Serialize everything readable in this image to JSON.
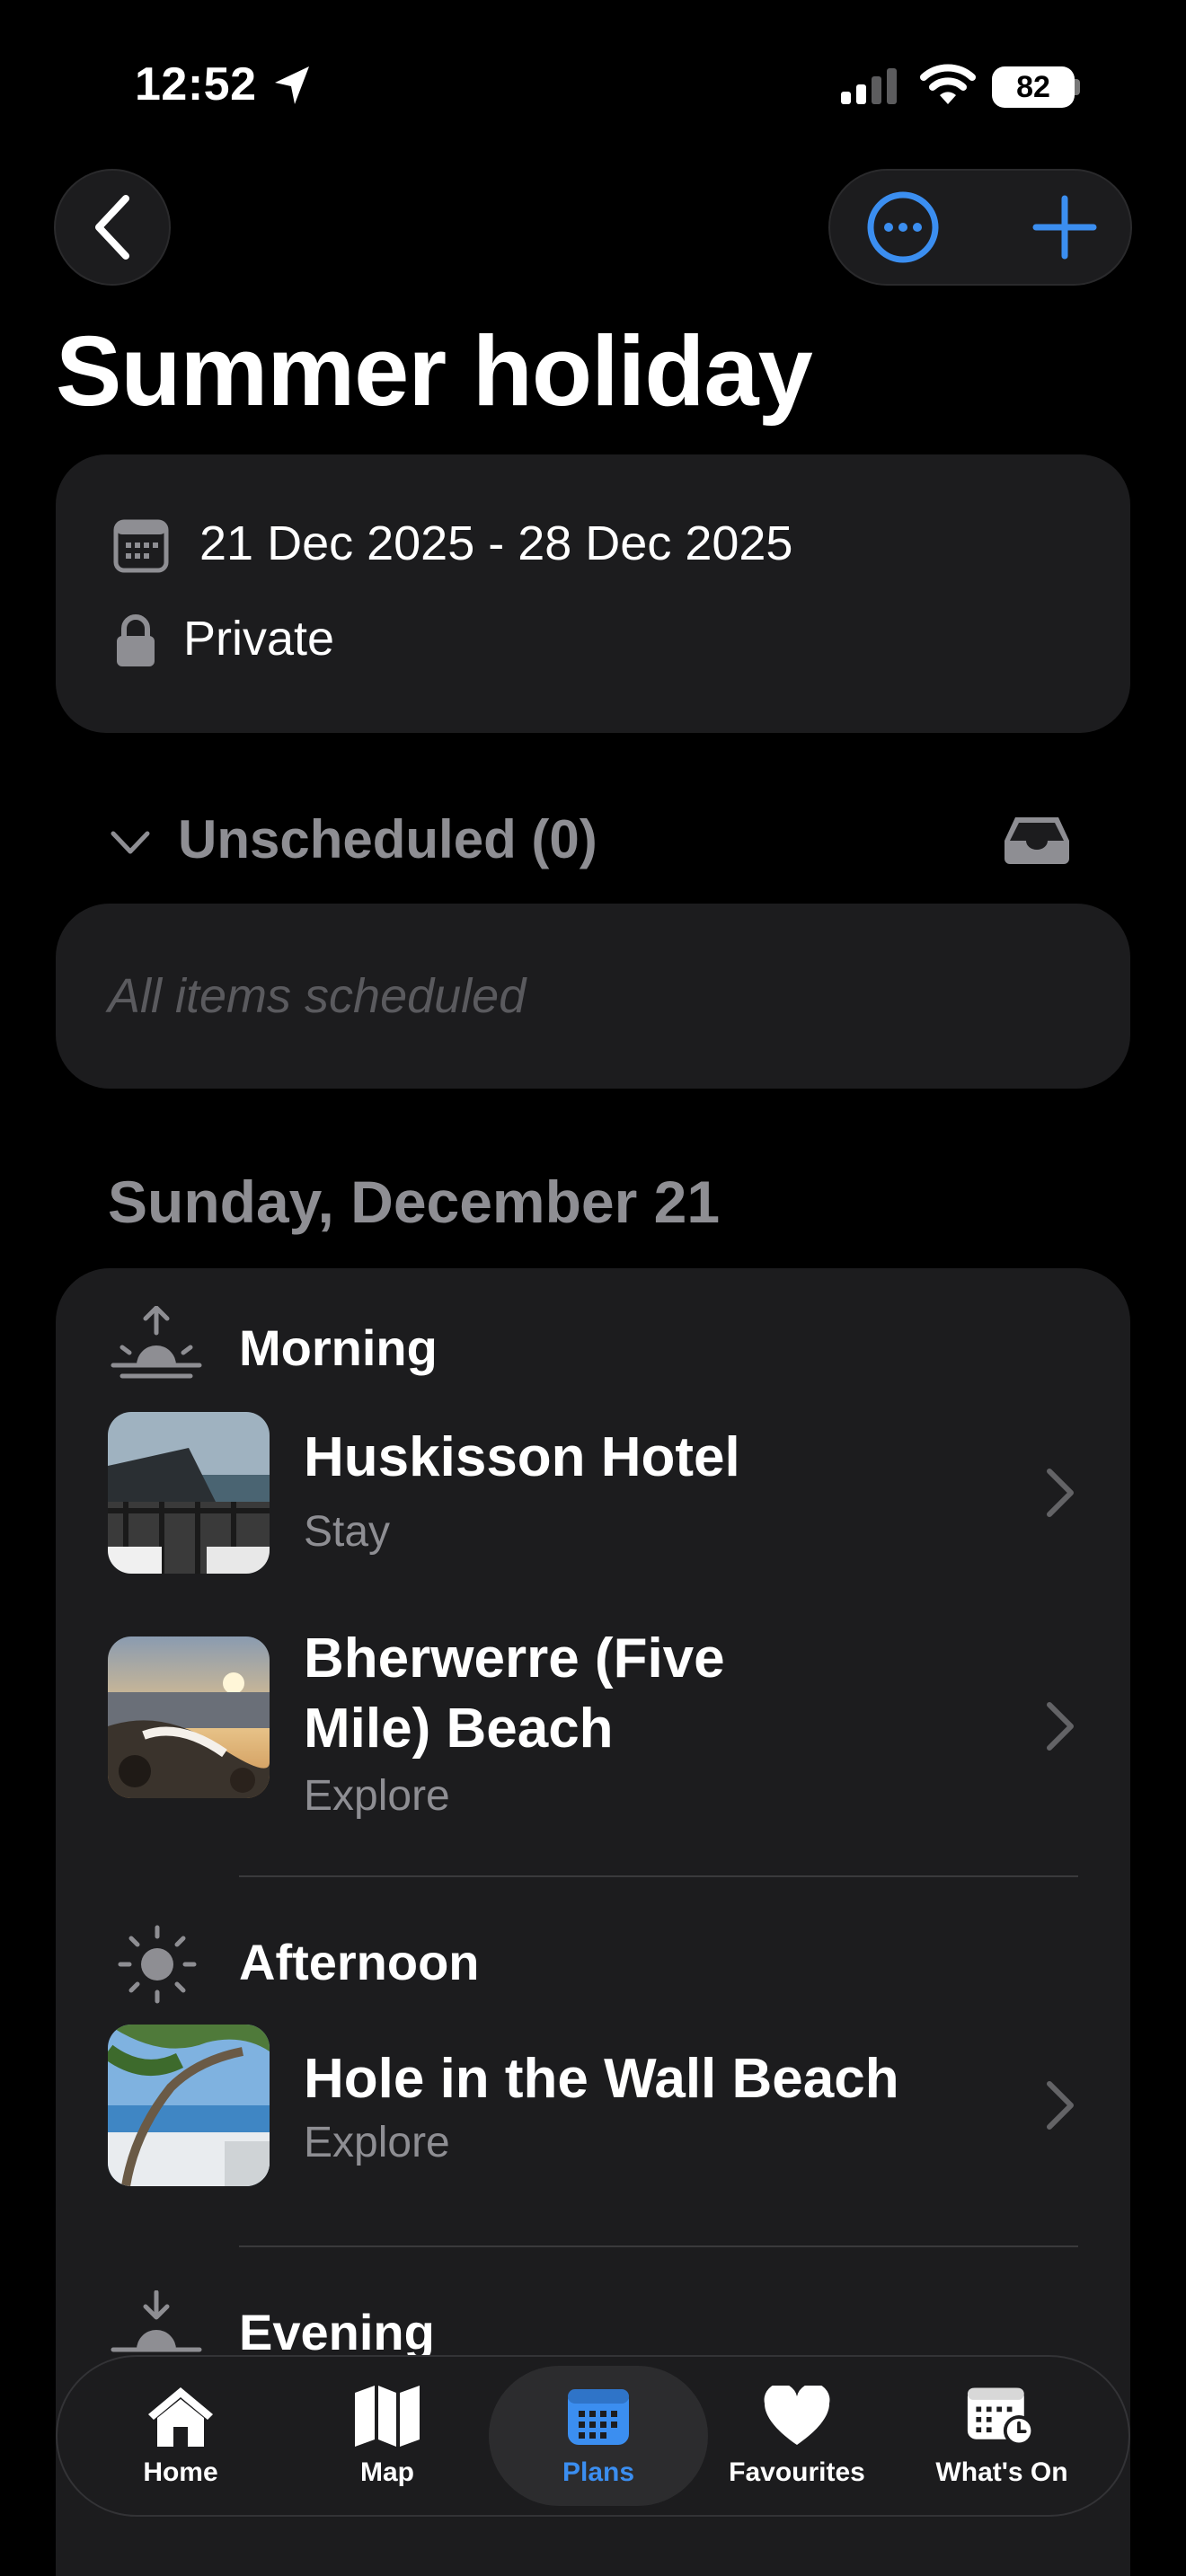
{
  "status_bar": {
    "time": "12:52",
    "battery": "82"
  },
  "header": {
    "title": "Summer holiday"
  },
  "trip_info": {
    "dates": "21 Dec 2025 - 28 Dec 2025",
    "visibility": "Private"
  },
  "unscheduled": {
    "label": "Unscheduled (0)",
    "empty_text": "All items scheduled"
  },
  "day": {
    "heading": "Sunday, December 21",
    "periods": [
      {
        "label": "Morning",
        "items": [
          {
            "title": "Huskisson Hotel",
            "category": "Stay"
          },
          {
            "title_line1": "Bherwerre (Five",
            "title_line2": "Mile) Beach",
            "category": "Explore"
          }
        ]
      },
      {
        "label": "Afternoon",
        "items": [
          {
            "title": "Hole in the Wall Beach",
            "category": "Explore"
          }
        ]
      },
      {
        "label": "Evening",
        "items": []
      }
    ]
  },
  "tabs": [
    {
      "label": "Home",
      "icon": "house-icon"
    },
    {
      "label": "Map",
      "icon": "map-icon"
    },
    {
      "label": "Plans",
      "icon": "calendar-icon",
      "active": true
    },
    {
      "label": "Favourites",
      "icon": "heart-icon"
    },
    {
      "label": "What's On",
      "icon": "calendar-clock-icon"
    }
  ],
  "colors": {
    "accent": "#3b8ef0",
    "card": "#1c1c1e",
    "secondary_text": "#8e8e93"
  }
}
